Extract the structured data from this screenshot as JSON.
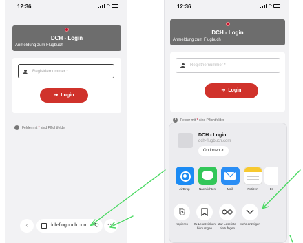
{
  "left_phone": {
    "status": {
      "time": "12:36"
    },
    "header": {
      "title": "DCH - Login",
      "subtitle": "Anmeldung zum Flugbuch"
    },
    "form": {
      "input_placeholder": "Registriernummer *",
      "login_label": "Login",
      "note_text": "Felder mit",
      "note_required": "*",
      "note_suffix": "sind Pflichtfelder"
    },
    "browser": {
      "domain": "dch-flugbuch.com",
      "back": "‹",
      "more": "···",
      "reload": "↻"
    }
  },
  "right_phone": {
    "status": {
      "time": "12:36"
    },
    "header": {
      "title": "DCH - Login",
      "subtitle": "Anmeldung zum Flugbuch"
    },
    "form": {
      "input_placeholder": "Registriernummer *",
      "login_label": "Login",
      "note_text": "Felder mit",
      "note_required": "*",
      "note_suffix": "sind Pflichtfelder"
    },
    "share_sheet": {
      "title": "DCH - Login",
      "url": "dch-flugbuch.com",
      "options_label": "Optionen >",
      "apps": [
        {
          "label": "AirDrop",
          "icon": "airdrop-icon"
        },
        {
          "label": "Nachrichten",
          "icon": "messages-icon"
        },
        {
          "label": "Mail",
          "icon": "mail-icon"
        },
        {
          "label": "Notizen",
          "icon": "notes-icon"
        },
        {
          "label": "Er",
          "icon": "more-apps-icon"
        }
      ],
      "actions": [
        {
          "label": "Kopieren",
          "icon": "copy-icon"
        },
        {
          "label": "Zu Lesezeichen hinzufügen",
          "icon": "bookmark-icon"
        },
        {
          "label": "Zur Leseliste hinzufügen",
          "icon": "reading-list-icon"
        },
        {
          "label": "Mehr anzeigen",
          "icon": "chevron-down-icon"
        }
      ]
    }
  },
  "colors": {
    "accent_red": "#d0322b",
    "header_gray": "#6d6d6d",
    "annotation_green": "#4cd964"
  }
}
